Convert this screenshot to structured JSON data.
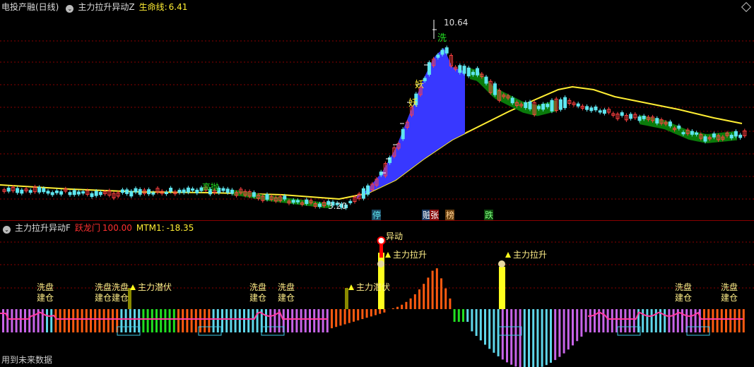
{
  "top_header": {
    "title": "电投产融(日线)",
    "indicator": "主力拉升异动Z",
    "line_label": "生命线:",
    "line_value": "6.41"
  },
  "bottom_header": {
    "indicator": "主力拉升异动F",
    "label1": "跃龙门",
    "value1": "100.00",
    "label2": "MTM1:",
    "value2": "-18.35"
  },
  "footer_text": "用到未来数据",
  "colors": {
    "up": "#ff4040",
    "down": "#5fe6f0",
    "lifeline": "#ffee33",
    "band_blue": "#3838ff",
    "band_green": "#0a7a0a",
    "orange": "#ff5a10",
    "purple": "#c764e8",
    "cyan": "#5fd6ea",
    "green": "#21e021",
    "yellow": "#ffff1e",
    "pink": "#ff3aa0",
    "grid": "#8a0000"
  },
  "chart_data": {
    "type": "candlestick",
    "price_high_label": "10.64",
    "price_low_label": "3.20",
    "candle_labels": [
      "妖",
      "妖",
      "洗"
    ],
    "bottom_labels": [
      "停",
      "赃",
      "张",
      "榜",
      "跌"
    ],
    "misc_label": "高抛",
    "bottom_signals": [
      {
        "text": "洗盘"
      },
      {
        "text": "建仓"
      },
      {
        "text": "洗盘洗盘"
      },
      {
        "text": "建仓建仓"
      },
      {
        "text": "主力潜伏"
      },
      {
        "text": "洗盘"
      },
      {
        "text": "建仓"
      },
      {
        "text": "洗盘"
      },
      {
        "text": "建仓"
      },
      {
        "text": "主力潜伏"
      },
      {
        "text": "主力拉升"
      },
      {
        "text": "主力拉升"
      },
      {
        "text": "洗盘"
      },
      {
        "text": "建仓"
      },
      {
        "text": "洗盘"
      },
      {
        "text": "建仓"
      },
      {
        "text": "异动"
      }
    ]
  }
}
